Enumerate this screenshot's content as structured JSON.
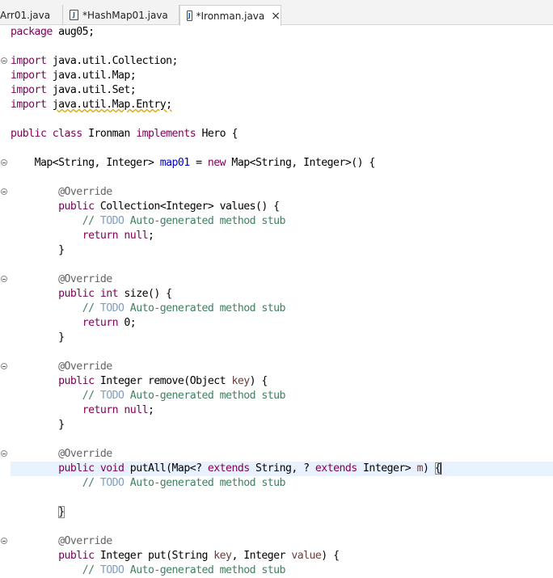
{
  "tabs": [
    {
      "label": "Arr01.java",
      "dirty": false,
      "active": false
    },
    {
      "label": "*HashMap01.java",
      "dirty": true,
      "active": false
    },
    {
      "label": "*Ironman.java",
      "dirty": true,
      "active": true
    }
  ],
  "tab_close_glyph": "×",
  "file_icon_glyph": "J",
  "code": {
    "package_kw": "package",
    "package_name": " aug05;",
    "imports": [
      "java.util.Collection;",
      "java.util.Map;",
      "java.util.Set;",
      "java.util.Map.Entry;"
    ],
    "import_kw": "import",
    "class_decl": {
      "public": "public",
      "class": "class",
      "name": " Ironman ",
      "implements": "implements",
      "iface": " Hero {"
    },
    "field": {
      "type": "Map<String, Integer> ",
      "name": "map01",
      "eq": " = ",
      "new": "new",
      "rest": " Map<String, Integer>() {"
    },
    "override": "@Override",
    "todo_prefix": "// ",
    "todo_word": "TODO",
    "todo_rest": " Auto-generated method stub",
    "methods": {
      "values": {
        "mod": "public",
        "sig": " Collection<Integer> values() {",
        "ret_kw": "return",
        "ret_val": "null",
        "ret_end": ";"
      },
      "size": {
        "mod": "public",
        "type_kw": "int",
        "sig": " size() {",
        "ret_kw": "return",
        "ret_val": " 0;"
      },
      "remove": {
        "mod": "public",
        "sig_a": " Integer remove(Object ",
        "param": "key",
        "sig_b": ") {",
        "ret_kw": "return",
        "ret_val": "null",
        "ret_end": ";"
      },
      "putAll": {
        "mod": "public",
        "void": "void",
        "sig_a": " putAll(Map<? ",
        "ext1": "extends",
        "sig_b": " String, ? ",
        "ext2": "extends",
        "sig_c": " Integer> ",
        "param": "m",
        "sig_d": ") ",
        "open": "{",
        "close": "}"
      },
      "put": {
        "mod": "public",
        "sig_a": " Integer put(String ",
        "p1": "key",
        "sig_b": ", Integer ",
        "p2": "value",
        "sig_c": ") {"
      }
    },
    "close_brace": "}"
  },
  "colors": {
    "keyword": "#7f0055",
    "annotation": "#646464",
    "field": "#0000c0",
    "comment": "#3f7f5f",
    "todo": "#7f9fbf",
    "current_line": "#e8f2fe"
  }
}
